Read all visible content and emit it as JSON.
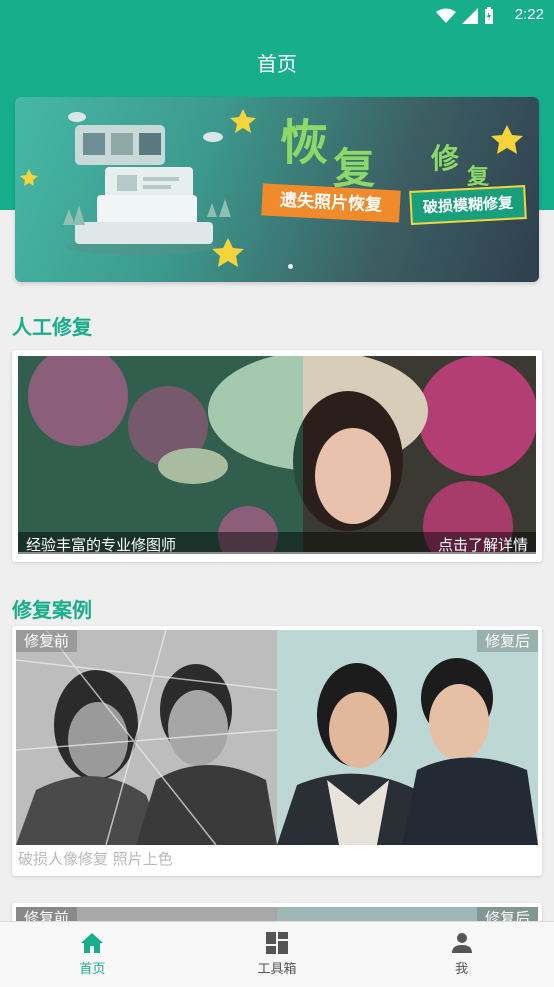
{
  "status_bar": {
    "time": "2:22"
  },
  "header": {
    "title": "首页"
  },
  "banner": {
    "headline1": "恢",
    "headline2": "复",
    "headline3": "修",
    "headline4": "复",
    "tag_left": "遗失照片恢复",
    "tag_right": "破损模糊修复"
  },
  "manual": {
    "section_title": "人工修复",
    "caption_left": "经验丰富的专业修图师",
    "caption_right": "点击了解详情"
  },
  "cases": {
    "section_title": "修复案例",
    "before_label": "修复前",
    "after_label": "修复后",
    "description": "破损人像修复 照片上色",
    "next_before_label": "修复前",
    "next_after_label": "修复后"
  },
  "nav": {
    "home": "首页",
    "tools": "工具箱",
    "me": "我"
  },
  "colors": {
    "accent": "#17ae8c"
  }
}
